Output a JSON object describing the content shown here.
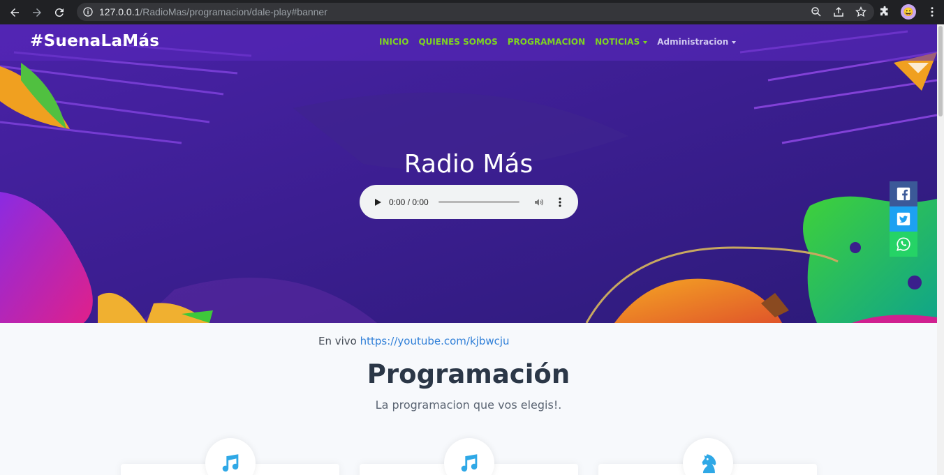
{
  "browser": {
    "url_host": "127.0.0.1",
    "url_path": "/RadioMas/programacion/dale-play#banner",
    "profile_icon": "profile-avatar"
  },
  "navbar": {
    "brand": "#SuenaLaMás",
    "items": [
      {
        "label": "INICIO"
      },
      {
        "label": "QUIENES SOMOS"
      },
      {
        "label": "PROGRAMACION"
      },
      {
        "label": "NOTICIAS"
      },
      {
        "label": "Administracion"
      }
    ]
  },
  "hero": {
    "title": "Radio Más"
  },
  "audio": {
    "time": "0:00 / 0:00"
  },
  "share": {
    "facebook_icon": "facebook-icon",
    "twitter_icon": "twitter-icon",
    "whatsapp_icon": "whatsapp-icon"
  },
  "content": {
    "live_prefix": "En vivo",
    "live_link": "https://youtube.com/kjbwcju",
    "section_title": "Programación",
    "section_subtitle": "La programacion que vos elegis!."
  },
  "cards": [
    {
      "icon": "music-note-icon"
    },
    {
      "icon": "music-note-icon"
    },
    {
      "icon": "horse-chess-icon"
    }
  ],
  "colors": {
    "nav_link": "#7ed321",
    "hero_bg": "#3a1f8c",
    "accent_blue": "#2fa8e6"
  }
}
